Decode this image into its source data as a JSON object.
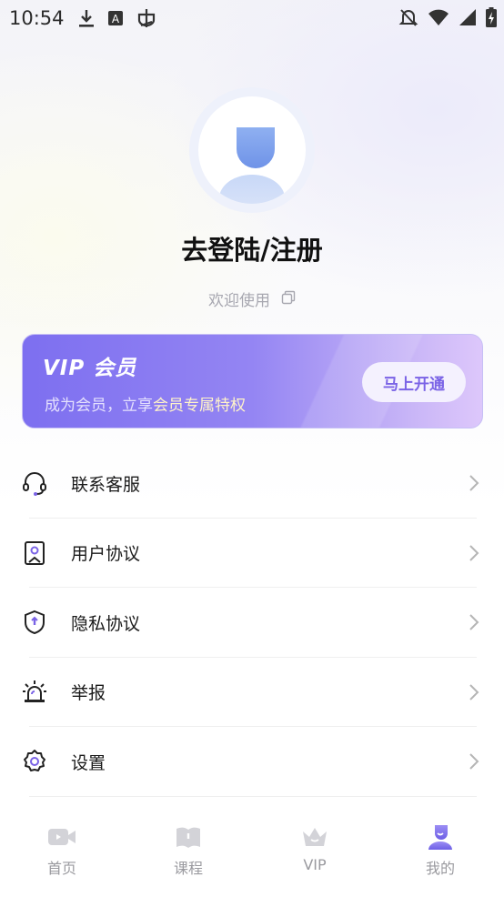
{
  "status_bar": {
    "time": "10:54",
    "icons": [
      "download-icon",
      "a-box-icon",
      "bug-icon",
      "notifications-off-icon",
      "wifi-icon",
      "signal-icon",
      "battery-charging-icon"
    ]
  },
  "profile": {
    "login_title": "去登陆/注册",
    "welcome_text": "欢迎使用"
  },
  "vip_card": {
    "title": "VIP 会员",
    "subtitle_prefix": "成为会员，立享",
    "subtitle_highlight": "会员专属特权",
    "button_label": "马上开通"
  },
  "menu": {
    "items": [
      {
        "label": "联系客服",
        "icon": "headset-icon"
      },
      {
        "label": "用户协议",
        "icon": "user-agreement-icon"
      },
      {
        "label": "隐私协议",
        "icon": "shield-icon"
      },
      {
        "label": "举报",
        "icon": "alarm-icon"
      },
      {
        "label": "设置",
        "icon": "gear-icon"
      }
    ]
  },
  "bottom_nav": {
    "items": [
      {
        "label": "首页",
        "icon": "video-camera-icon"
      },
      {
        "label": "课程",
        "icon": "book-icon"
      },
      {
        "label": "VIP",
        "icon": "crown-icon"
      },
      {
        "label": "我的",
        "icon": "profile-icon",
        "active": true
      }
    ]
  },
  "colors": {
    "accent": "#7a63e6",
    "vip_gradient_start": "#7d6ff0",
    "vip_gradient_end": "#ddc7fb",
    "inactive_nav": "#c9c9ce"
  }
}
